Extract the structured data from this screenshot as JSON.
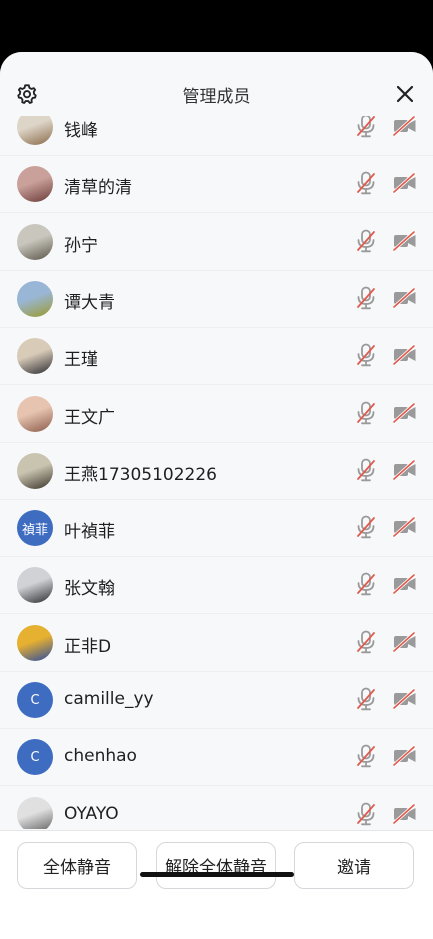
{
  "header": {
    "title": "管理成员"
  },
  "members": [
    {
      "name": "钱峰",
      "avatar": {
        "kind": "photo",
        "colors": [
          "#ddd5c8",
          "#8a6a48"
        ]
      }
    },
    {
      "name": "清草的清",
      "avatar": {
        "kind": "photo",
        "colors": [
          "#c9a09a",
          "#6a3a38"
        ]
      }
    },
    {
      "name": "孙宁",
      "avatar": {
        "kind": "photo",
        "colors": [
          "#c8c6bd",
          "#5a5548"
        ]
      }
    },
    {
      "name": "谭大青",
      "avatar": {
        "kind": "photo",
        "colors": [
          "#9ab6d6",
          "#9a9a2a"
        ]
      }
    },
    {
      "name": "王瑾",
      "avatar": {
        "kind": "photo",
        "colors": [
          "#d8cbb8",
          "#2a2a30"
        ]
      }
    },
    {
      "name": "王文广",
      "avatar": {
        "kind": "photo",
        "colors": [
          "#e6c4b0",
          "#8a5a48"
        ]
      }
    },
    {
      "name": "王燕17305102226",
      "avatar": {
        "kind": "photo",
        "colors": [
          "#c9c4b0",
          "#3a342a"
        ]
      }
    },
    {
      "name": "叶禎菲",
      "avatar": {
        "kind": "text",
        "text": "禎菲",
        "colors": [
          "#3e6cc0",
          "#3e6cc0"
        ]
      }
    },
    {
      "name": "张文翰",
      "avatar": {
        "kind": "photo",
        "colors": [
          "#d0d2d6",
          "#2a2c30"
        ]
      }
    },
    {
      "name": "正非D",
      "avatar": {
        "kind": "photo",
        "colors": [
          "#e6b030",
          "#2a4aa0"
        ]
      }
    },
    {
      "name": "camille_yy",
      "avatar": {
        "kind": "text",
        "text": "C",
        "colors": [
          "#3e6cc0",
          "#3e6cc0"
        ]
      }
    },
    {
      "name": "chenhao",
      "avatar": {
        "kind": "text",
        "text": "C",
        "colors": [
          "#3e6cc0",
          "#3e6cc0"
        ]
      }
    },
    {
      "name": "OYAYO",
      "avatar": {
        "kind": "photo",
        "colors": [
          "#e0e0e0",
          "#5a5a5a"
        ]
      }
    }
  ],
  "footer": {
    "mute_all_label": "全体静音",
    "unmute_all_label": "解除全体静音",
    "invite_label": "邀请"
  },
  "colors": {
    "muted_icon": "#e05a4e",
    "icon_gray": "#9a9a9a",
    "avatar_blue": "#3e6cc0"
  },
  "icons": {
    "settings": "gear-icon",
    "close": "close-icon",
    "microphone_muted": "mic-off-icon",
    "camera_off": "camera-off-icon"
  }
}
